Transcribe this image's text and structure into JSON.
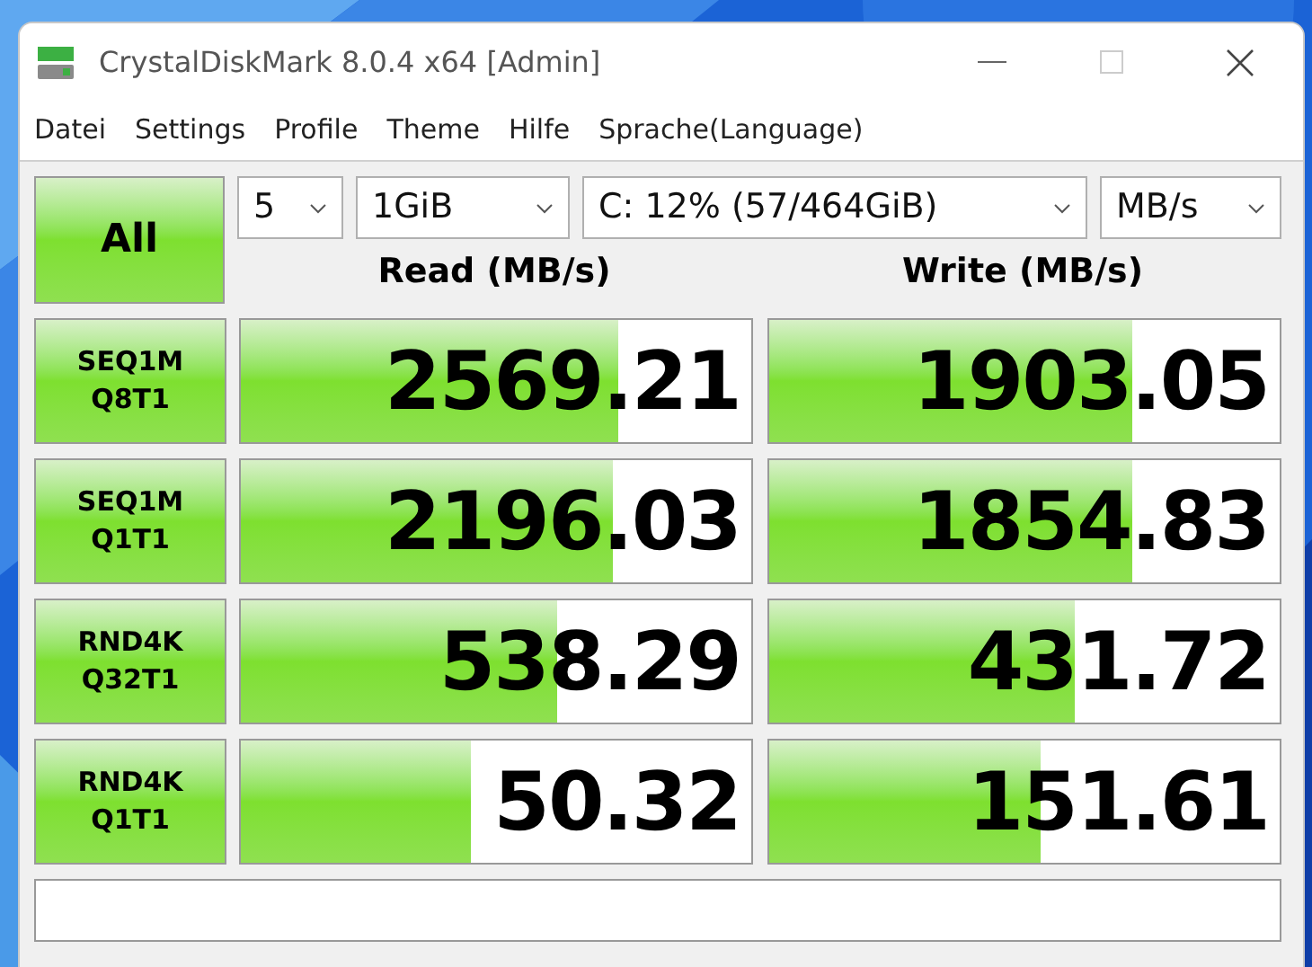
{
  "window": {
    "title": "CrystalDiskMark 8.0.4 x64 [Admin]"
  },
  "menu": [
    "Datei",
    "Settings",
    "Profile",
    "Theme",
    "Hilfe",
    "Sprache(Language)"
  ],
  "all_button": {
    "label": "All"
  },
  "selectors": [
    {
      "value": "5"
    },
    {
      "value": "1GiB"
    },
    {
      "value": "C: 12% (57/464GiB)"
    },
    {
      "value": "MB/s"
    }
  ],
  "columns": [
    "Read (MB/s)",
    "Write (MB/s)"
  ],
  "tests": [
    {
      "line1": "SEQ1M",
      "line2": "Q8T1",
      "read": {
        "value": "2569.21",
        "level": 0.74
      },
      "write": {
        "value": "1903.05",
        "level": 0.71
      }
    },
    {
      "line1": "SEQ1M",
      "line2": "Q1T1",
      "read": {
        "value": "2196.03",
        "level": 0.73
      },
      "write": {
        "value": "1854.83",
        "level": 0.71
      }
    },
    {
      "line1": "RND4K",
      "line2": "Q32T1",
      "read": {
        "value": "538.29",
        "level": 0.62
      },
      "write": {
        "value": "431.72",
        "level": 0.6
      }
    },
    {
      "line1": "RND4K",
      "line2": "Q1T1",
      "read": {
        "value": "50.32",
        "level": 0.45
      },
      "write": {
        "value": "151.61",
        "level": 0.53
      }
    }
  ]
}
